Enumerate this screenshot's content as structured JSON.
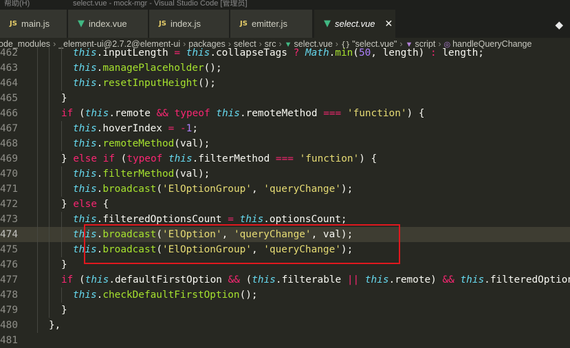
{
  "window": {
    "menu_label": "帮助(H)",
    "title": "select.vue - mock-mgr - Visual Studio Code [管理员]"
  },
  "tabs": [
    {
      "label": "main.js",
      "icon": "js-file-icon",
      "icon_text": "JS",
      "kind": "js",
      "active": false
    },
    {
      "label": "index.vue",
      "icon": "vue-file-icon",
      "icon_text": "▼",
      "kind": "vue",
      "active": false
    },
    {
      "label": "index.js",
      "icon": "js-file-icon",
      "icon_text": "JS",
      "kind": "js",
      "active": false
    },
    {
      "label": "emitter.js",
      "icon": "js-file-icon",
      "icon_text": "JS",
      "kind": "js",
      "active": false
    },
    {
      "label": "select.vue",
      "icon": "vue-file-icon",
      "icon_text": "▼",
      "kind": "vue",
      "active": true
    }
  ],
  "tab_close_glyph": "✕",
  "split_editor_glyph": "◆",
  "breadcrumb": {
    "items": [
      "ode_modules",
      "_element-ui@2.7.2@element-ui",
      "packages",
      "select",
      "src",
      "select.vue",
      "\"select.vue\"",
      "script",
      "handleQueryChange"
    ],
    "separator": "›",
    "select_vue_icon": "▼",
    "object_icon": "{}",
    "script_icon": "▼",
    "method_icon": "◎"
  },
  "colors": {
    "background": "#272822",
    "keyword": "#f92672",
    "this": "#66d9ef",
    "function": "#a6e22e",
    "string": "#e6db74",
    "number": "#ae81ff",
    "highlight_box": "#e0181e"
  },
  "code": {
    "current_line": 474,
    "highlighted_lines": [
      474,
      475
    ],
    "lines": [
      {
        "n": "462",
        "indent": 3,
        "tokens": [
          [
            "v",
            "this"
          ],
          [
            "p",
            "."
          ],
          [
            "p",
            "inputLength"
          ],
          [
            "p",
            " "
          ],
          [
            "t",
            "="
          ],
          [
            "p",
            " "
          ],
          [
            "v",
            "this"
          ],
          [
            "p",
            "."
          ],
          [
            "p",
            "collapseTags"
          ],
          [
            "p",
            " "
          ],
          [
            "t",
            "?"
          ],
          [
            "p",
            " "
          ],
          [
            "v",
            "Math"
          ],
          [
            "p",
            "."
          ],
          [
            "f",
            "min"
          ],
          [
            "p",
            "("
          ],
          [
            "n",
            "50"
          ],
          [
            "p",
            ", length) "
          ],
          [
            "t",
            ":"
          ],
          [
            "p",
            " length;"
          ]
        ]
      },
      {
        "n": "463",
        "indent": 3,
        "tokens": [
          [
            "v",
            "this"
          ],
          [
            "p",
            "."
          ],
          [
            "f",
            "managePlaceholder"
          ],
          [
            "p",
            "();"
          ]
        ]
      },
      {
        "n": "464",
        "indent": 3,
        "tokens": [
          [
            "v",
            "this"
          ],
          [
            "p",
            "."
          ],
          [
            "f",
            "resetInputHeight"
          ],
          [
            "p",
            "();"
          ]
        ]
      },
      {
        "n": "465",
        "indent": 2,
        "tokens": [
          [
            "p",
            "}"
          ]
        ]
      },
      {
        "n": "466",
        "indent": 2,
        "tokens": [
          [
            "t",
            "if"
          ],
          [
            "p",
            " ("
          ],
          [
            "v",
            "this"
          ],
          [
            "p",
            ".remote "
          ],
          [
            "t",
            "&&"
          ],
          [
            "p",
            " "
          ],
          [
            "t",
            "typeof"
          ],
          [
            "p",
            " "
          ],
          [
            "v",
            "this"
          ],
          [
            "p",
            ".remoteMethod "
          ],
          [
            "t",
            "==="
          ],
          [
            "p",
            " "
          ],
          [
            "s",
            "'function'"
          ],
          [
            "p",
            ") {"
          ]
        ]
      },
      {
        "n": "467",
        "indent": 3,
        "tokens": [
          [
            "v",
            "this"
          ],
          [
            "p",
            ".hoverIndex "
          ],
          [
            "t",
            "="
          ],
          [
            "p",
            " "
          ],
          [
            "t",
            "-"
          ],
          [
            "n",
            "1"
          ],
          [
            "p",
            ";"
          ]
        ]
      },
      {
        "n": "468",
        "indent": 3,
        "tokens": [
          [
            "v",
            "this"
          ],
          [
            "p",
            "."
          ],
          [
            "f",
            "remoteMethod"
          ],
          [
            "p",
            "(val);"
          ]
        ]
      },
      {
        "n": "469",
        "indent": 2,
        "tokens": [
          [
            "p",
            "} "
          ],
          [
            "t",
            "else"
          ],
          [
            "p",
            " "
          ],
          [
            "t",
            "if"
          ],
          [
            "p",
            " ("
          ],
          [
            "t",
            "typeof"
          ],
          [
            "p",
            " "
          ],
          [
            "v",
            "this"
          ],
          [
            "p",
            ".filterMethod "
          ],
          [
            "t",
            "==="
          ],
          [
            "p",
            " "
          ],
          [
            "s",
            "'function'"
          ],
          [
            "p",
            ") {"
          ]
        ]
      },
      {
        "n": "470",
        "indent": 3,
        "tokens": [
          [
            "v",
            "this"
          ],
          [
            "p",
            "."
          ],
          [
            "f",
            "filterMethod"
          ],
          [
            "p",
            "(val);"
          ]
        ]
      },
      {
        "n": "471",
        "indent": 3,
        "tokens": [
          [
            "v",
            "this"
          ],
          [
            "p",
            "."
          ],
          [
            "f",
            "broadcast"
          ],
          [
            "p",
            "("
          ],
          [
            "s",
            "'ElOptionGroup'"
          ],
          [
            "p",
            ", "
          ],
          [
            "s",
            "'queryChange'"
          ],
          [
            "p",
            ");"
          ]
        ]
      },
      {
        "n": "472",
        "indent": 2,
        "tokens": [
          [
            "p",
            "} "
          ],
          [
            "t",
            "else"
          ],
          [
            "p",
            " {"
          ]
        ]
      },
      {
        "n": "473",
        "indent": 3,
        "tokens": [
          [
            "v",
            "this"
          ],
          [
            "p",
            ".filteredOptionsCount "
          ],
          [
            "t",
            "="
          ],
          [
            "p",
            " "
          ],
          [
            "v",
            "this"
          ],
          [
            "p",
            ".optionsCount;"
          ]
        ]
      },
      {
        "n": "474",
        "indent": 3,
        "tokens": [
          [
            "v",
            "this"
          ],
          [
            "p",
            "."
          ],
          [
            "f",
            "broadcast"
          ],
          [
            "p",
            "("
          ],
          [
            "s",
            "'ElOption'"
          ],
          [
            "p",
            ", "
          ],
          [
            "s",
            "'queryChange'"
          ],
          [
            "p",
            ", val);"
          ]
        ]
      },
      {
        "n": "475",
        "indent": 3,
        "tokens": [
          [
            "v",
            "this"
          ],
          [
            "p",
            "."
          ],
          [
            "f",
            "broadcast"
          ],
          [
            "p",
            "("
          ],
          [
            "s",
            "'ElOptionGroup'"
          ],
          [
            "p",
            ", "
          ],
          [
            "s",
            "'queryChange'"
          ],
          [
            "p",
            ");"
          ]
        ]
      },
      {
        "n": "476",
        "indent": 2,
        "tokens": [
          [
            "p",
            "}"
          ]
        ]
      },
      {
        "n": "477",
        "indent": 2,
        "tokens": [
          [
            "t",
            "if"
          ],
          [
            "p",
            " ("
          ],
          [
            "v",
            "this"
          ],
          [
            "p",
            ".defaultFirstOption "
          ],
          [
            "t",
            "&&"
          ],
          [
            "p",
            " ("
          ],
          [
            "v",
            "this"
          ],
          [
            "p",
            ".filterable "
          ],
          [
            "t",
            "||"
          ],
          [
            "p",
            " "
          ],
          [
            "v",
            "this"
          ],
          [
            "p",
            ".remote) "
          ],
          [
            "t",
            "&&"
          ],
          [
            "p",
            " "
          ],
          [
            "v",
            "this"
          ],
          [
            "p",
            ".filteredOptionsCount) {"
          ]
        ]
      },
      {
        "n": "478",
        "indent": 3,
        "tokens": [
          [
            "v",
            "this"
          ],
          [
            "p",
            "."
          ],
          [
            "f",
            "checkDefaultFirstOption"
          ],
          [
            "p",
            "();"
          ]
        ]
      },
      {
        "n": "479",
        "indent": 2,
        "tokens": [
          [
            "p",
            "}"
          ]
        ]
      },
      {
        "n": "480",
        "indent": 1,
        "tokens": [
          [
            "p",
            "},"
          ]
        ]
      },
      {
        "n": "481",
        "indent": 0,
        "tokens": []
      }
    ]
  }
}
